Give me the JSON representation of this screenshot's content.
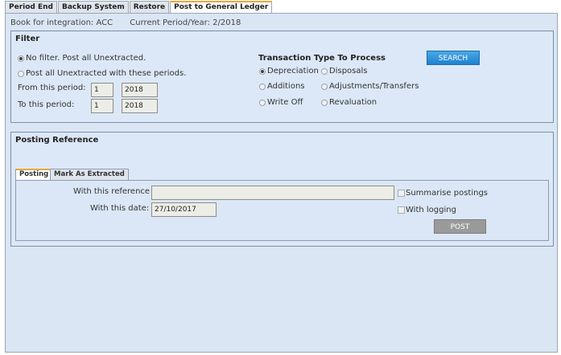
{
  "tabs": [
    "Period End",
    "Backup System",
    "Restore",
    "Post to General Ledger"
  ],
  "info": {
    "book": "Book for integration: ACC",
    "period": "Current Period/Year: 2/2018"
  },
  "filter": {
    "title": "Filter",
    "options": [
      "No filter. Post all Unextracted.",
      "Post all Unextracted with these periods."
    ],
    "from_label": "From this period:",
    "from_period": "1",
    "from_year": "2018",
    "to_label": "To this period:",
    "to_period": "1",
    "to_year": "2018",
    "transaction_title": "Transaction Type To Process",
    "types": [
      "Depreciation",
      "Disposals",
      "Additions",
      "Adjustments/Transfers",
      "Write Off",
      "Revaluation"
    ],
    "search_label": "SEARCH"
  },
  "posting": {
    "title": "Posting Reference",
    "tabs": [
      "Posting",
      "Mark As Extracted"
    ],
    "reference_label": "With this reference",
    "reference_value": "",
    "date_label": "With this date:",
    "date_value": "27/10/2017",
    "summarise_label": "Summarise postings",
    "logging_label": "With logging",
    "post_label": "POST"
  }
}
